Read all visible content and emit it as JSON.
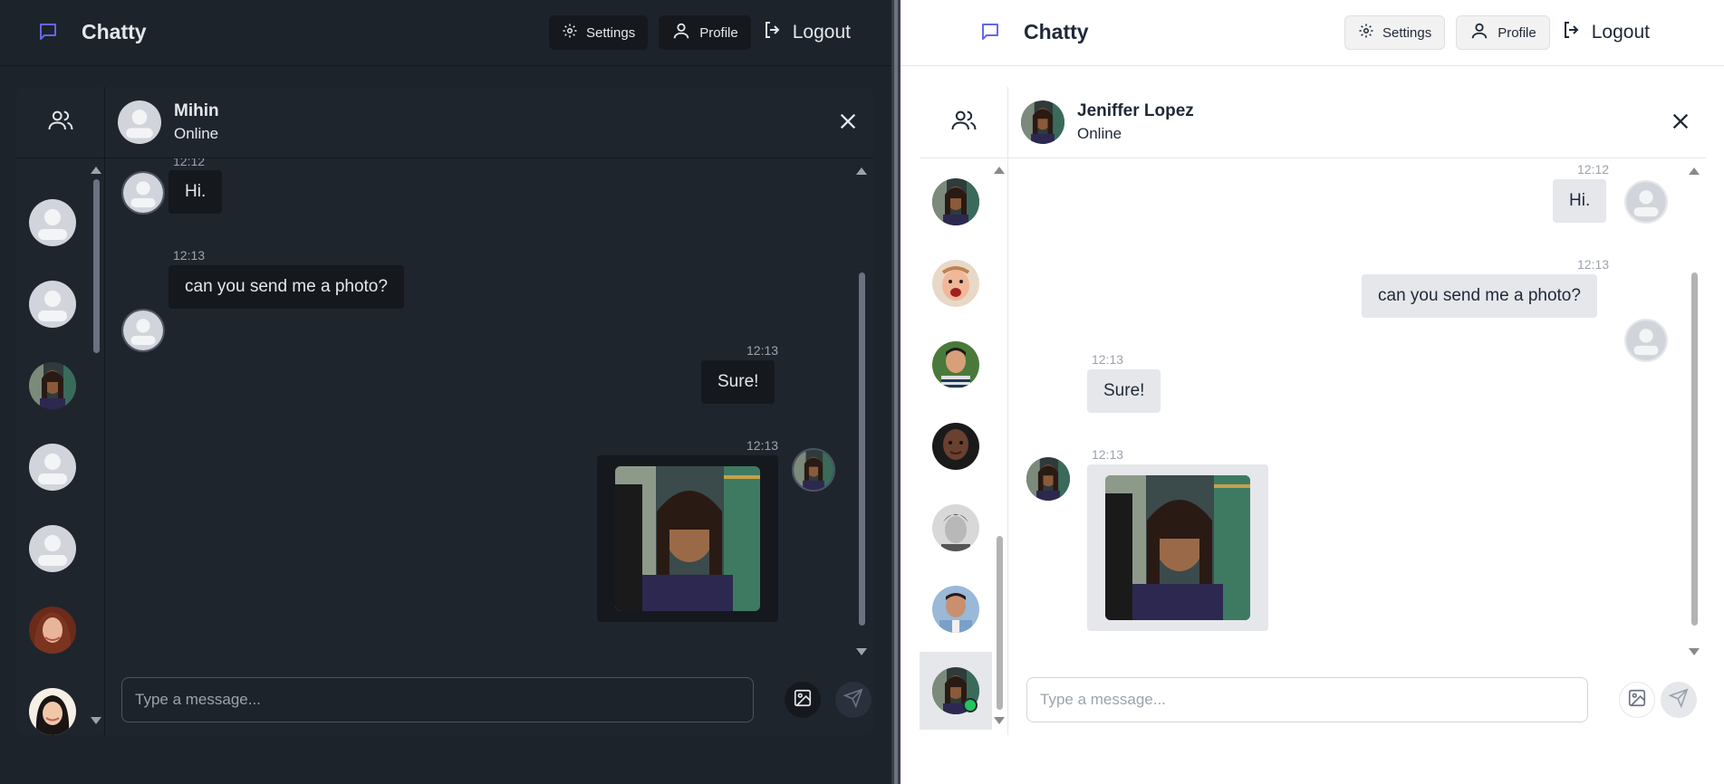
{
  "colors": {
    "brand_accent": "#6366f1",
    "online": "#22c55e",
    "dark_bg": "#1d232a",
    "light_bg": "#ffffff"
  },
  "left": {
    "app_name": "Chatty",
    "nav": {
      "settings": "Settings",
      "profile": "Profile",
      "logout": "Logout"
    },
    "chat": {
      "name": "Mihin",
      "status": "Online"
    },
    "messages": [
      {
        "time": "12:12",
        "text": "Hi."
      },
      {
        "time": "12:13",
        "text": "can you send me a photo?"
      },
      {
        "time": "12:13",
        "text": "Sure!"
      },
      {
        "time": "12:13",
        "image": "photo"
      }
    ],
    "input_placeholder": "Type a message..."
  },
  "right": {
    "app_name": "Chatty",
    "nav": {
      "settings": "Settings",
      "profile": "Profile",
      "logout": "Logout"
    },
    "chat": {
      "name": "Jeniffer Lopez",
      "status": "Online"
    },
    "messages": [
      {
        "time": "12:12",
        "text": "Hi."
      },
      {
        "time": "12:13",
        "text": "can you send me a photo?"
      },
      {
        "time": "12:13",
        "text": "Sure!"
      },
      {
        "time": "12:13",
        "image": "photo"
      }
    ],
    "input_placeholder": "Type a message..."
  }
}
